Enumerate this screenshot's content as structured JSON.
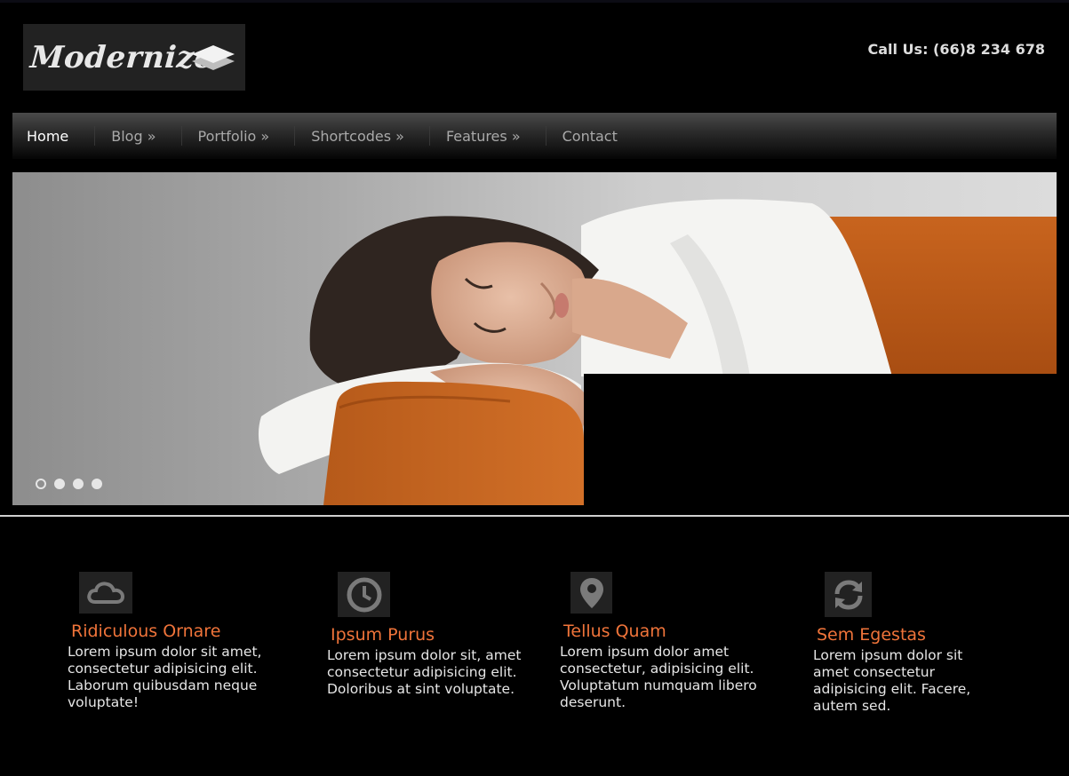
{
  "header": {
    "logo_text": "Modernize",
    "call_us": "Call Us: (66)8 234 678"
  },
  "nav": {
    "items": [
      {
        "label": "Home",
        "active": true
      },
      {
        "label": "Blog »"
      },
      {
        "label": "Portfolio »"
      },
      {
        "label": "Shortcodes »"
      },
      {
        "label": "Features »"
      },
      {
        "label": "Contact"
      }
    ]
  },
  "slider": {
    "dot_count": 4,
    "active_index": 0
  },
  "features": [
    {
      "icon": "cloud-icon",
      "title": "Ridiculous Ornare",
      "text": "Lorem ipsum dolor sit amet, consectetur adipisicing elit. Laborum quibusdam neque voluptate!"
    },
    {
      "icon": "clock-icon",
      "title": "Ipsum Purus",
      "text": "Lorem ipsum dolor sit, amet consectetur adipisicing elit. Doloribus at sint voluptate."
    },
    {
      "icon": "map-pin-icon",
      "title": "Tellus Quam",
      "text": "Lorem ipsum dolor amet consectetur, adipisicing elit. Voluptatum numquam libero deserunt."
    },
    {
      "icon": "refresh-icon",
      "title": "Sem Egestas",
      "text": "Lorem ipsum dolor sit amet consectetur adipisicing elit. Facere, autem sed."
    }
  ],
  "colors": {
    "accent": "#f0743a",
    "background": "#000000",
    "nav_active": "#ffffff",
    "nav_inactive": "#a9a9a9"
  }
}
